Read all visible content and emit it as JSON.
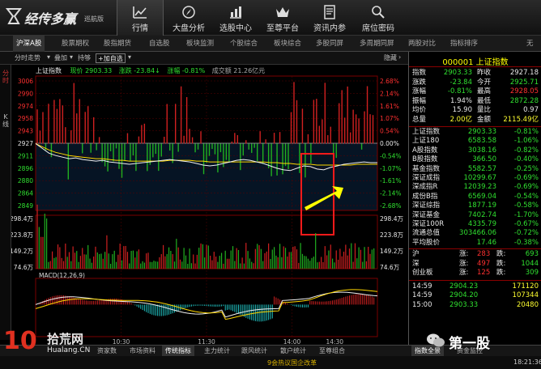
{
  "app": {
    "logo_text": "经传多赢",
    "logo_sub": "巡航版"
  },
  "nav": [
    {
      "label": "行情",
      "icon": "trend-chart-icon"
    },
    {
      "label": "大盘分析",
      "icon": "compass-icon"
    },
    {
      "label": "选股中心",
      "icon": "bar-chart-icon"
    },
    {
      "label": "至尊平台",
      "icon": "crown-icon"
    },
    {
      "label": "资讯内参",
      "icon": "document-icon"
    },
    {
      "label": "席位密码",
      "icon": "search-icon"
    }
  ],
  "subtabs": [
    "沪深A股",
    "股票期权",
    "股指期货",
    "自选股",
    "板块监测",
    "个股综合",
    "板块综合",
    "多股同屏",
    "多周期同屏",
    "两股对比",
    "指标排序"
  ],
  "subtab_more": "无",
  "toolbar": {
    "view": "分时走势",
    "overlay": "叠加",
    "sub": "持够",
    "add_watch": "+加自选",
    "hide": "隐藏"
  },
  "left_tabs": [
    "分时",
    "K线"
  ],
  "chart_header": {
    "name": "上证指数",
    "current_label": "现价",
    "current": "2903.33",
    "change_label": "涨跌",
    "change": "-23.84",
    "pct_label": "涨幅",
    "pct": "-0.81%",
    "amount_label": "成交额",
    "amount": "21.26亿元"
  },
  "macd_label": "MACD(12,26,9)",
  "chart_data": {
    "type": "line",
    "price_axis_left": [
      "3006",
      "2990",
      "2974",
      "2958",
      "2943",
      "2927",
      "2911",
      "2896",
      "2880",
      "2864",
      "2849"
    ],
    "price_axis_right": [
      "2.68%",
      "2.14%",
      "1.61%",
      "1.07%",
      "0.54%",
      "0.00%",
      "-0.54%",
      "-1.07%",
      "-1.61%",
      "-2.14%",
      "-2.68%"
    ],
    "volume_axis_left": [
      "298.4万",
      "223.8万",
      "149.2万",
      "74.6万"
    ],
    "volume_axis_right": [
      "298.4万",
      "223.8万",
      "149.2万",
      "74.6万"
    ],
    "macd_axis_right": [
      "0.00"
    ],
    "time_ticks": [
      "10:30",
      "11:30",
      "14:00",
      "14:30"
    ],
    "prev_close": 2927,
    "price_range": [
      2849,
      3006
    ],
    "price_series": [
      2927,
      2921,
      2915,
      2912,
      2910,
      2908,
      2909,
      2907,
      2906,
      2905,
      2906,
      2904,
      2903,
      2902,
      2901,
      2902,
      2903,
      2904,
      2905,
      2906,
      2907,
      2906,
      2905,
      2904,
      2902,
      2900,
      2899,
      2900,
      2902,
      2904,
      2906,
      2907,
      2906,
      2904,
      2902,
      2899,
      2896,
      2894,
      2893,
      2896,
      2899,
      2898,
      2895,
      2894,
      2897,
      2899,
      2901,
      2902,
      2903,
      2904,
      2903,
      2903
    ],
    "avg_series": [
      2927,
      2923,
      2919,
      2916,
      2914,
      2912,
      2911,
      2910,
      2909,
      2908,
      2908,
      2907,
      2906,
      2906,
      2905,
      2905,
      2905,
      2905,
      2905,
      2905,
      2906,
      2906,
      2906,
      2906,
      2905,
      2905,
      2904,
      2904,
      2904,
      2904,
      2904,
      2904,
      2904,
      2904,
      2904,
      2903,
      2903,
      2902,
      2902,
      2901,
      2901,
      2901,
      2900,
      2900,
      2900,
      2900,
      2900,
      2900,
      2901,
      2901,
      2901,
      2901
    ]
  },
  "right_panel": {
    "title": "000001 上证指数",
    "rows": [
      {
        "l1": "指数",
        "v1": "2903.33",
        "c1": "green",
        "l2": "昨收",
        "v2": "2927.18",
        "c2": "white"
      },
      {
        "l1": "涨跌",
        "v1": "-23.84",
        "c1": "green",
        "l2": "今开",
        "v2": "2925.71",
        "c2": "green"
      },
      {
        "l1": "涨幅",
        "v1": "-0.81%",
        "c1": "green",
        "l2": "最高",
        "v2": "2928.05",
        "c2": "red"
      },
      {
        "l1": "振幅",
        "v1": "1.94%",
        "c1": "white",
        "l2": "最低",
        "v2": "2872.28",
        "c2": "green"
      },
      {
        "l1": "均价",
        "v1": "15.90",
        "c1": "white",
        "l2": "量比",
        "v2": "0.97",
        "c2": "white"
      },
      {
        "l1": "总量",
        "v1": "2.00亿",
        "c1": "yellow",
        "l2": "金额",
        "v2": "2115.49亿",
        "c2": "yellow"
      }
    ],
    "indices": [
      {
        "name": "上证指数",
        "value": "2903.33",
        "pct": "-0.81%"
      },
      {
        "name": "上证180",
        "value": "6583.58",
        "pct": "-1.06%"
      },
      {
        "name": "A股指数",
        "value": "3038.16",
        "pct": "-0.82%"
      },
      {
        "name": "B股指数",
        "value": "366.50",
        "pct": "-0.40%"
      },
      {
        "name": "基金指数",
        "value": "5582.57",
        "pct": "-0.25%"
      },
      {
        "name": "深证成指",
        "value": "10299.67",
        "pct": "-0.69%"
      },
      {
        "name": "深成指R",
        "value": "12039.23",
        "pct": "-0.69%"
      },
      {
        "name": "成份B指",
        "value": "6569.04",
        "pct": "-0.54%"
      },
      {
        "name": "深证综指",
        "value": "1877.19",
        "pct": "-0.58%"
      },
      {
        "name": "深证基金",
        "value": "7402.74",
        "pct": "-1.70%"
      },
      {
        "name": "深证100R",
        "value": "4335.79",
        "pct": "-0.67%"
      },
      {
        "name": "流通总值",
        "value": "303466.06",
        "pct": "-0.72%"
      },
      {
        "name": "平均股价",
        "value": "17.46",
        "pct": "-0.38%"
      }
    ],
    "breadth": [
      {
        "name": "沪",
        "up_label": "涨:",
        "up": "283",
        "down_label": "跌:",
        "down": "693"
      },
      {
        "name": "深",
        "up_label": "涨:",
        "up": "497",
        "down_label": "跌:",
        "down": "1044"
      },
      {
        "name": "创业板",
        "up_label": "涨:",
        "up": "125",
        "down_label": "跌:",
        "down": "309"
      }
    ],
    "ticks": [
      {
        "time": "14:59",
        "price": "2904.23",
        "vol": "171120"
      },
      {
        "time": "14:59",
        "price": "2904.20",
        "vol": "107344"
      },
      {
        "time": "15:00",
        "price": "2903.33",
        "vol": "20480"
      }
    ]
  },
  "bottom_tabs": [
    "资家数",
    "市场资料",
    "传统指标",
    "主力统计",
    "跟风统计",
    "散户统计",
    "至尊组合"
  ],
  "bottom_right_tabs": [
    "指数全景",
    "资金监控"
  ],
  "status": {
    "center": "9会热议国企改革",
    "time": "18:21:36"
  },
  "watermark_left": {
    "num": "10",
    "text": "拾荒网",
    "url": "Hualang.CN"
  },
  "watermark_right": {
    "text": "第一股"
  }
}
